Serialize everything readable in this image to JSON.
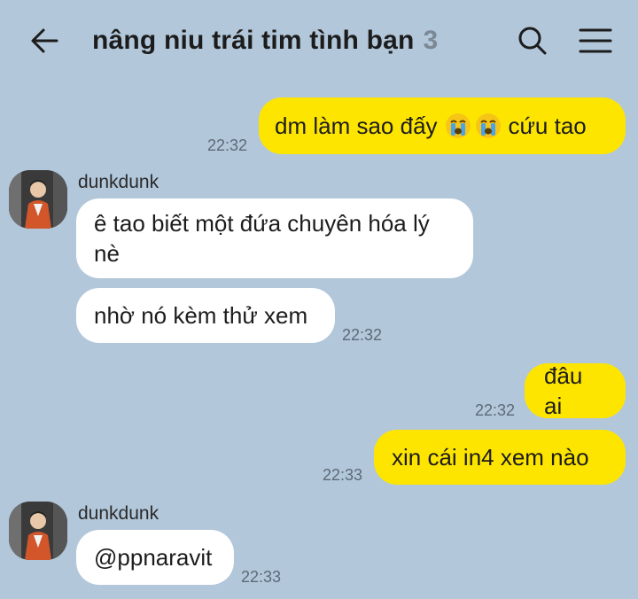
{
  "header": {
    "title": "nâng niu trái tim tình bạn",
    "member_count": "3"
  },
  "messages": [
    {
      "side": "out",
      "text_before": "dm làm sao đấy",
      "emoji": [
        "crying-face",
        "crying-face"
      ],
      "text_after": "cứu tao",
      "time": "22:32"
    },
    {
      "side": "in",
      "sender": "dunkdunk",
      "text": "ê tao biết một đứa chuyên hóa lý nè"
    },
    {
      "side": "in",
      "text": "nhờ nó kèm thử xem",
      "time": "22:32"
    },
    {
      "side": "out",
      "text": "đâu ai",
      "time": "22:32"
    },
    {
      "side": "out",
      "text": "xin cái in4 xem nào",
      "time": "22:33"
    },
    {
      "side": "in",
      "sender": "dunkdunk",
      "text": "@ppnaravit",
      "time": "22:33"
    }
  ],
  "colors": {
    "background": "#b2c7da",
    "outgoing_bubble": "#fee500",
    "incoming_bubble": "#ffffff"
  }
}
